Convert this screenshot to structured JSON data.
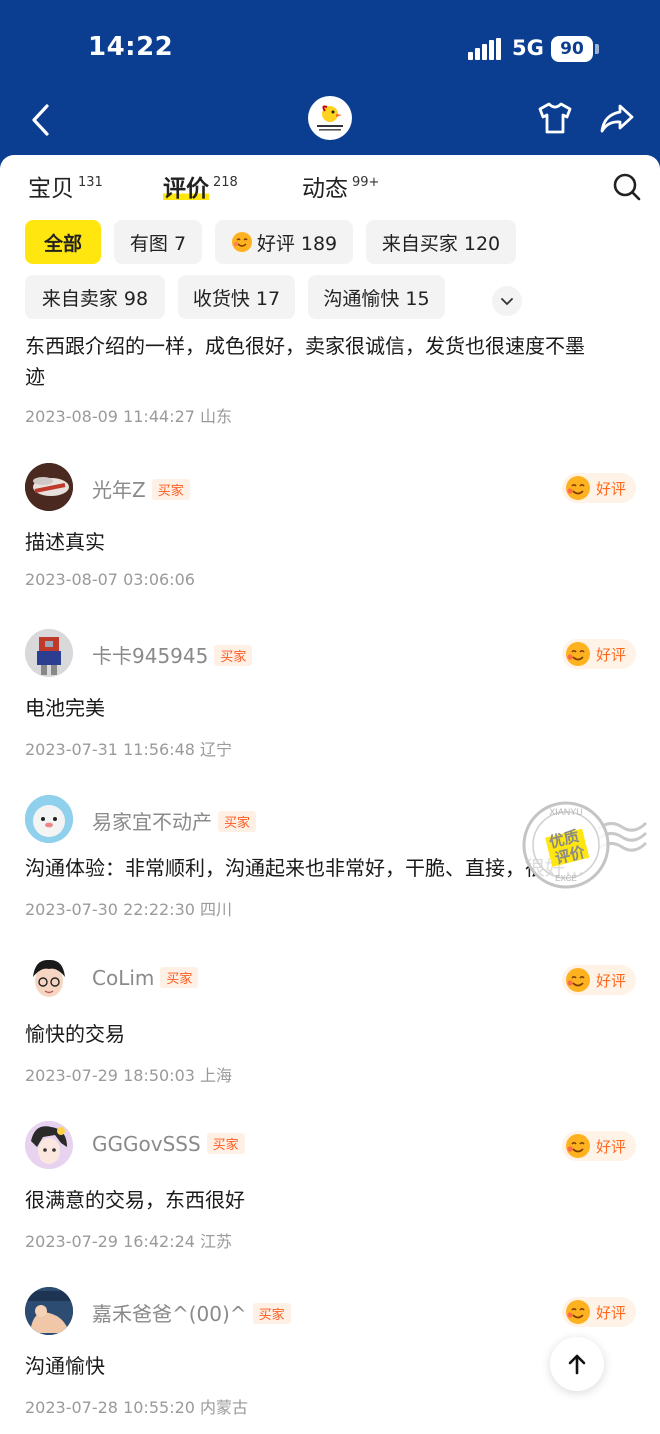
{
  "status_bar": {
    "time": "14:22",
    "network": "5G",
    "battery": "90"
  },
  "nav": {
    "logo_alt": "A.Dudoh 小黄鸭",
    "icons": [
      "chevron-left-icon",
      "shirt-icon",
      "share-icon"
    ]
  },
  "tabs": [
    {
      "label": "宝贝",
      "count": "131"
    },
    {
      "label": "评价",
      "count": "218"
    },
    {
      "label": "动态",
      "count": "99+"
    }
  ],
  "filters": [
    {
      "label": "全部"
    },
    {
      "label": "有图 7"
    },
    {
      "label": "好评 189"
    },
    {
      "label": "来自买家 120"
    },
    {
      "label": "来自卖家 98"
    },
    {
      "label": "收货快 17"
    },
    {
      "label": "沟通愉快 15"
    }
  ],
  "partial_review": {
    "text_line1": "东西跟介绍的一样，成色很好，卖家很诚信，发货也很速度不墨",
    "text_line2": "迹",
    "meta": "2023-08-09 11:44:27 山东"
  },
  "reviews": [
    {
      "user": "光年Z",
      "role": "买家",
      "rating": "好评",
      "text": "描述真实",
      "meta": "2023-08-07 03:06:06"
    },
    {
      "user": "卡卡945945",
      "role": "买家",
      "rating": "好评",
      "text": "电池完美",
      "meta": "2023-07-31 11:56:48 辽宁"
    },
    {
      "user": "易家宜不动产",
      "role": "买家",
      "rating": "",
      "text": "沟通体验：非常顺利，沟通起来也非常好，干脆、直接，很好...",
      "meta": "2023-07-30 22:22:30 四川"
    },
    {
      "user": "CoLim",
      "role": "买家",
      "rating": "好评",
      "text": "愉快的交易",
      "meta": "2023-07-29 18:50:03 上海"
    },
    {
      "user": "GGGovSSS",
      "role": "买家",
      "rating": "好评",
      "text": "很满意的交易，东西很好",
      "meta": "2023-07-29 16:42:24 江苏"
    },
    {
      "user": "嘉禾爸爸^(00)^",
      "role": "买家",
      "rating": "好评",
      "text": "沟通愉快",
      "meta": "2023-07-28 10:55:20 内蒙古"
    }
  ],
  "stamp": {
    "top": "XIANYU",
    "line1": "优质",
    "line2": "评价",
    "bottom": "EXCE"
  },
  "colors": {
    "brand": "#0b3d91",
    "accent": "#ffe60f",
    "badge": "#ff5a1f"
  }
}
